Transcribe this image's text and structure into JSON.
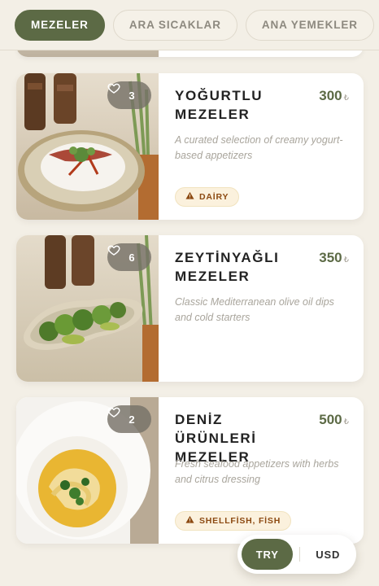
{
  "tabs": [
    {
      "label": "MEZELER",
      "active": true
    },
    {
      "label": "ARA SICAKLAR",
      "active": false
    },
    {
      "label": "ANA YEMEKLER",
      "active": false
    }
  ],
  "cards": [
    {
      "title": "YOĞURTLU MEZELER",
      "price": "300",
      "currency_symbol": "₺",
      "likes": "3",
      "description": "A curated selection of creamy yogurt-based appetizers",
      "tag": "DAİRY"
    },
    {
      "title": "ZEYTİNYAĞLI MEZELER",
      "price": "350",
      "currency_symbol": "₺",
      "likes": "6",
      "description": "Classic Mediterranean olive oil dips and cold starters",
      "tag": ""
    },
    {
      "title": "DENİZ ÜRÜNLERİ MEZELER",
      "price": "500",
      "currency_symbol": "₺",
      "likes": "2",
      "description": "Fresh seafood appetizers with herbs and citrus dressing",
      "tag": "SHELLFİSH, FİSH"
    }
  ],
  "currency_switch": {
    "selected": "TRY",
    "other": "USD"
  },
  "colors": {
    "accent": "#5c6a45",
    "background": "#f3efe6",
    "tag_text": "#8c4a12"
  },
  "icons": {
    "likes": "heart-icon",
    "tag": "warning-icon"
  }
}
